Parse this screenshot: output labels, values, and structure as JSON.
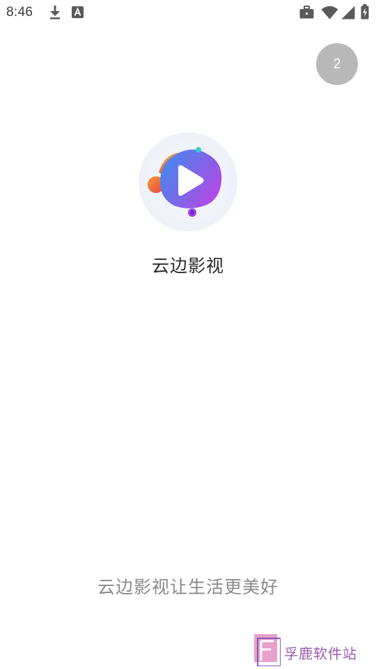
{
  "status_bar": {
    "time": "8:46",
    "icons": [
      "download-icon",
      "text-a-icon",
      "briefcase-icon",
      "wifi-icon",
      "signal-icon",
      "battery-icon"
    ]
  },
  "splash": {
    "countdown": "2",
    "app_name": "云边影视",
    "slogan": "云边影视让生活更美好"
  },
  "watermark": {
    "text": "孚鹿软件站"
  },
  "colors": {
    "countdown_bg": "#b8b8b8",
    "app_name": "#2b2b2b",
    "slogan": "#8a8a8a",
    "watermark": "#9a59b0"
  }
}
